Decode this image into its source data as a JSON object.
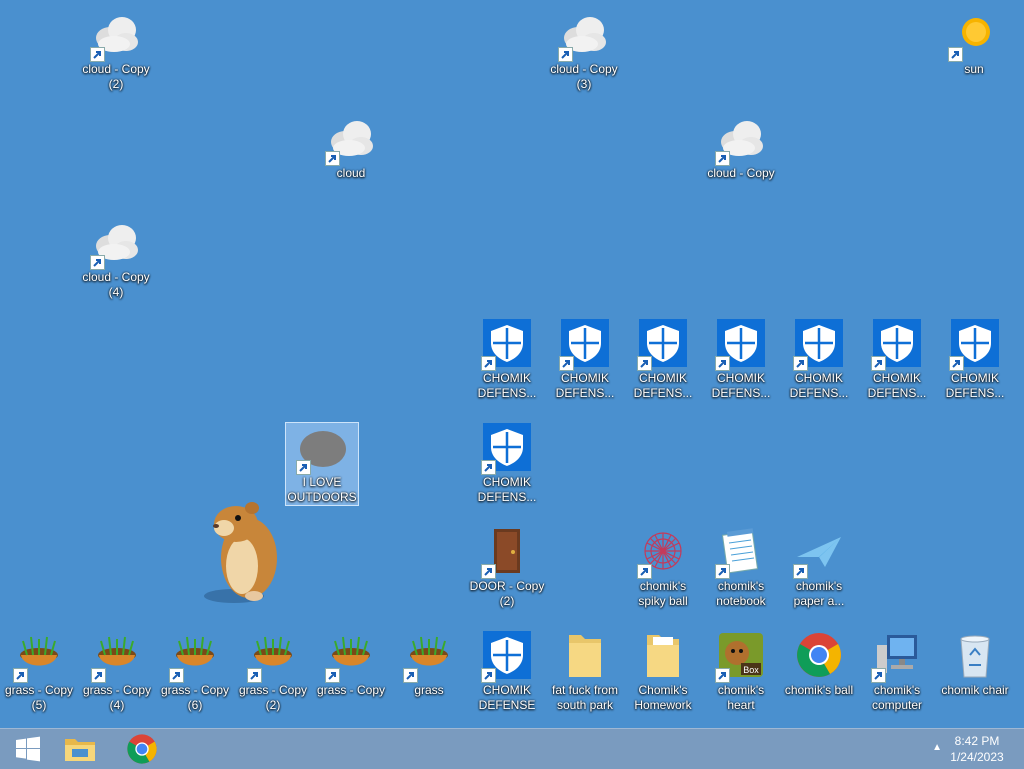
{
  "desktop": {
    "icons": [
      {
        "label": "cloud - Copy\n(2)"
      },
      {
        "label": "cloud - Copy\n(3)"
      },
      {
        "label": "sun"
      },
      {
        "label": "cloud"
      },
      {
        "label": "cloud - Copy"
      },
      {
        "label": "cloud - Copy\n(4)"
      },
      {
        "label": "CHOMIK\nDEFENS..."
      },
      {
        "label": "CHOMIK\nDEFENS..."
      },
      {
        "label": "CHOMIK\nDEFENS..."
      },
      {
        "label": "CHOMIK\nDEFENS..."
      },
      {
        "label": "CHOMIK\nDEFENS..."
      },
      {
        "label": "CHOMIK\nDEFENS..."
      },
      {
        "label": "CHOMIK\nDEFENS..."
      },
      {
        "label": "I LOVE\nOUTDOORS"
      },
      {
        "label": "CHOMIK\nDEFENS..."
      },
      {
        "label": "DOOR - Copy\n(2)"
      },
      {
        "label": "chomik's\nspiky ball"
      },
      {
        "label": "chomik's\nnotebook"
      },
      {
        "label": "chomik's\npaper a..."
      },
      {
        "label": "grass - Copy\n(5)"
      },
      {
        "label": "grass - Copy\n(4)"
      },
      {
        "label": "grass - Copy\n(6)"
      },
      {
        "label": "grass - Copy\n(2)"
      },
      {
        "label": "grass - Copy"
      },
      {
        "label": "grass"
      },
      {
        "label": "CHOMIK\nDEFENSE"
      },
      {
        "label": "fat fuck from\nsouth park"
      },
      {
        "label": "Chomik's\nHomework"
      },
      {
        "label": "chomik's\nheart"
      },
      {
        "label": "chomik's ball"
      },
      {
        "label": "chomik's\ncomputer"
      },
      {
        "label": "chomik chair"
      }
    ]
  },
  "taskbar": {
    "time": "8:42 PM",
    "date": "1/24/2023"
  },
  "colors": {
    "desktop": "#4A90CF",
    "taskbar": "#7A9BBF",
    "shield": "#0E6FD6"
  }
}
